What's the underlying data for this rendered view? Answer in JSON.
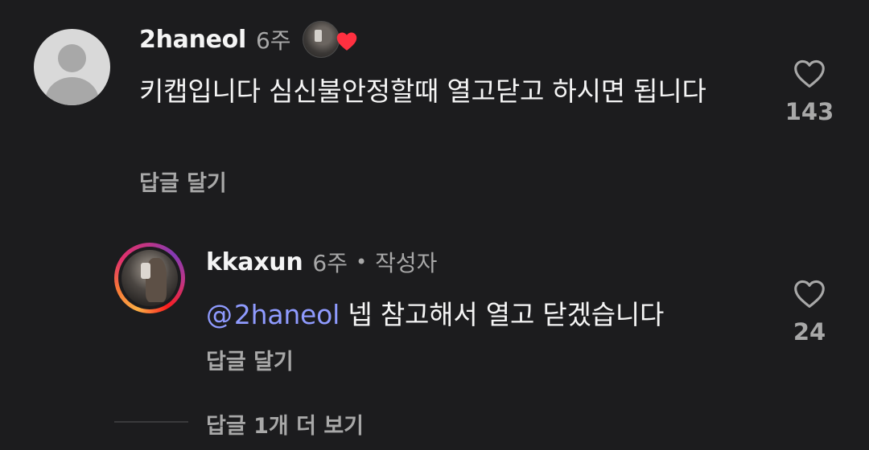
{
  "comments": [
    {
      "username": "2haneol",
      "time": "6주",
      "avatar": "default-avatar-icon",
      "liked_by_author": true,
      "text": "키캡입니다 심신불안정할때 열고닫고 하시면 됩니다",
      "reply_label": "답글 달기",
      "likes": "143"
    }
  ],
  "reply": {
    "username": "kkaxun",
    "time": "6주",
    "separator": "•",
    "author_label": "작성자",
    "mention": "2haneol",
    "text": " 넵 참고해서 열고 닫겠습니다",
    "reply_label": "답글 달기",
    "likes": "24"
  },
  "more_replies_label": "답글 1개 더 보기",
  "colors": {
    "background": "#1c1c1e",
    "primary_text": "#f5f5f5",
    "secondary_text": "#a8a8a8",
    "mention": "#8f9bff",
    "heart": "#ff3040"
  }
}
